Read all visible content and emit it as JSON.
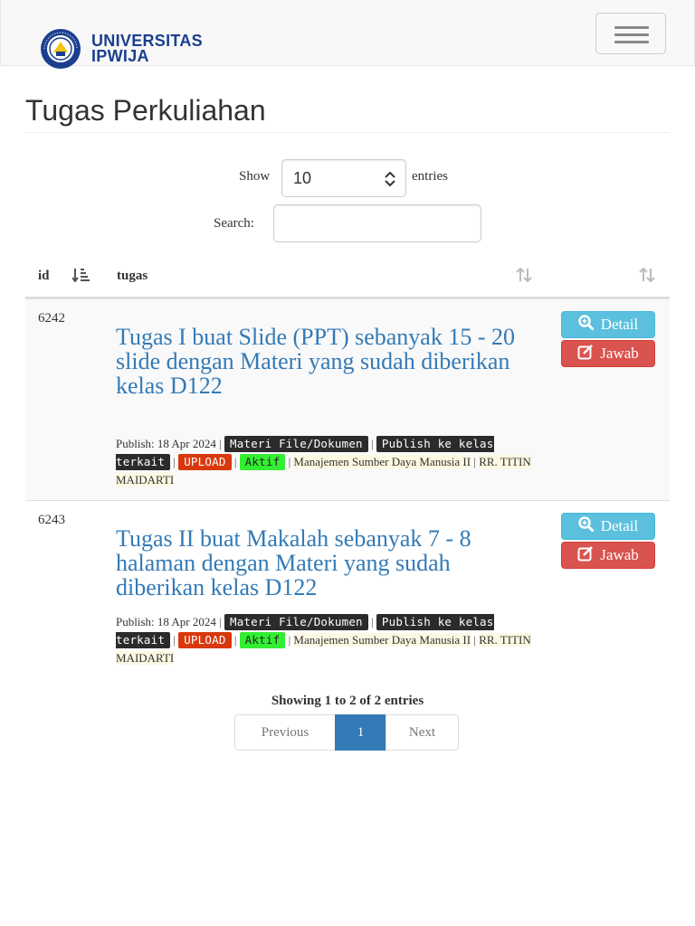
{
  "brand": {
    "line1": "UNIVERSITAS",
    "line2": "IPWIJA",
    "seal_text": "UNIVERSITAS IPWIJA",
    "color": "#1b3f8f"
  },
  "header": {
    "menu_icon": "hamburger-icon"
  },
  "page": {
    "title": "Tugas Perkuliahan"
  },
  "controls": {
    "show_label": "Show",
    "page_length": "10",
    "entries_label": "entries",
    "search_label": "Search:",
    "search_value": ""
  },
  "table": {
    "columns": [
      "id",
      "tugas",
      "",
      ""
    ],
    "rows": [
      {
        "id": "6242",
        "title": "Tugas I buat Slide (PPT) sebanyak 15 - 20 slide dengan Materi yang sudah diberikan kelas D122",
        "publish": "Publish: 18 Apr 2024",
        "tag_type": "Materi File/Dokumen",
        "tag_publish": "Publish ke kelas terkait",
        "tag_upload": "UPLOAD",
        "tag_status": "Aktif",
        "course": "Manajemen Sumber Daya Manusia II",
        "lecturer": "RR. TITIN MAIDARTI",
        "detail_label": "Detail",
        "jawab_label": "Jawab"
      },
      {
        "id": "6243",
        "title": "Tugas II buat Makalah sebanyak 7 - 8 halaman dengan Materi yang sudah diberikan kelas D122",
        "publish": "Publish: 18 Apr 2024",
        "tag_type": "Materi File/Dokumen",
        "tag_publish": "Publish ke kelas terkait",
        "tag_upload": "UPLOAD",
        "tag_status": "Aktif",
        "course": "Manajemen Sumber Daya Manusia II",
        "lecturer": "RR. TITIN MAIDARTI",
        "detail_label": "Detail",
        "jawab_label": "Jawab"
      }
    ]
  },
  "footer": {
    "info": "Showing 1 to 2 of 2 entries",
    "prev": "Previous",
    "current": "1",
    "next": "Next"
  },
  "colors": {
    "link": "#337ab7",
    "detail": "#5bc0de",
    "jawab": "#d9534f",
    "tag_dark": "#2b2b2b",
    "tag_upload": "#d9380e",
    "tag_active": "#33ee33",
    "highlight": "#fdf8e2"
  }
}
